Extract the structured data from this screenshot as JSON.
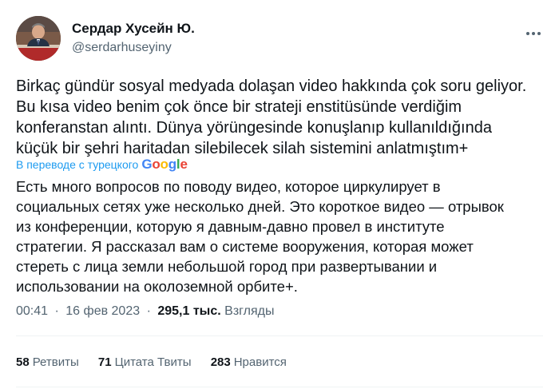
{
  "author": {
    "name": "Сердар Хусейн Ю.",
    "handle": "@serdarhuseyiny",
    "avatar_icon": "user-avatar-photo"
  },
  "tweet": {
    "original_lines": [
      "Birkaç gündür sosyal medyada dolaşan video hakkında çok soru geliyor.",
      "Bu kısa video benim çok önce bir strateji enstitüsünde verdiğim",
      "konferanstan alıntı. Dünya yörüngesinde konuşlanıp kullanıldığında",
      "küçük bir şehri haritadan silebilecek silah sistemini anlatmıştım+"
    ],
    "translation_label": "В переводе с турецкого",
    "translation_brand": "Google",
    "translated_lines": [
      "Есть много вопросов по поводу видео, которое циркулирует в",
      "социальных сетях уже несколько дней. Это короткое видео — отрывок",
      "из конференции, которую я давным-давно провел в институте",
      "стратегии. Я рассказал вам о системе вооружения, которая может",
      "стереть с лица земли небольшой город при развертывании и",
      "использовании на околоземной орбите+."
    ]
  },
  "meta": {
    "time": "00:41",
    "dot": "·",
    "date": "16 фев 2023",
    "views_count": "295,1 тыс.",
    "views_label": "Взгляды"
  },
  "stats": {
    "retweets_count": "58",
    "retweets_label": "Ретвиты",
    "quotes_count": "71",
    "quotes_label": "Цитата Твиты",
    "likes_count": "283",
    "likes_label": "Нравится"
  },
  "colors": {
    "text": "#0f1419",
    "secondary": "#536471",
    "link": "#1d9bf0",
    "divider": "#eff3f4"
  },
  "icons": {
    "more": "more-horizontal-icon"
  }
}
